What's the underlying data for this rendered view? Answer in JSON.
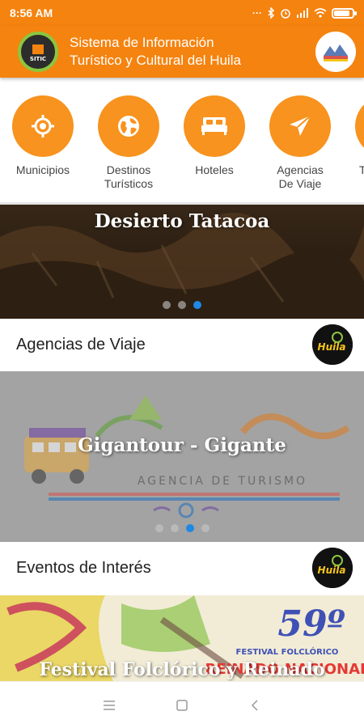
{
  "status_bar": {
    "time": "8:56 AM",
    "extra_icons": "···",
    "battery_level": 0.85
  },
  "header": {
    "title_line1": "Sistema de Información",
    "title_line2": "Turístico y Cultural del Huila",
    "logo_icon": "sitic-logo-icon",
    "huila_logo_icon": "huila-logo-icon"
  },
  "categories": [
    {
      "label": "Municipios",
      "icon": "location-target-icon"
    },
    {
      "label": "Destinos\nTurísticos",
      "icon": "globe-icon"
    },
    {
      "label": "Hoteles",
      "icon": "bed-icon"
    },
    {
      "label": "Agencias\nDe Viaje",
      "icon": "paper-plane-icon"
    },
    {
      "label": "T",
      "icon": "partial-category-icon"
    }
  ],
  "banners": {
    "destinos": {
      "caption": "Desierto Tatacoa",
      "dots": 3,
      "active_dot": 3
    },
    "agencias": {
      "caption": "Gigantour - Gigante",
      "dots": 4,
      "active_dot": 3,
      "logo_text": "Gigantour",
      "logo_subtitle": "AGENCIA DE TURISMO"
    },
    "eventos": {
      "caption": "Festival Folclórico y Reinado",
      "poster_number": "59º",
      "poster_line1": "FESTIVAL FOLCLÓRICO",
      "poster_line2": "REINADO NACIONAL"
    }
  },
  "sections": {
    "agencias_title": "Agencias de Viaje",
    "eventos_title": "Eventos de Interés",
    "badge_text": "Huila"
  },
  "colors": {
    "primary": "#f5830f",
    "category": "#f7931e",
    "active_dot": "#1e88e5"
  }
}
